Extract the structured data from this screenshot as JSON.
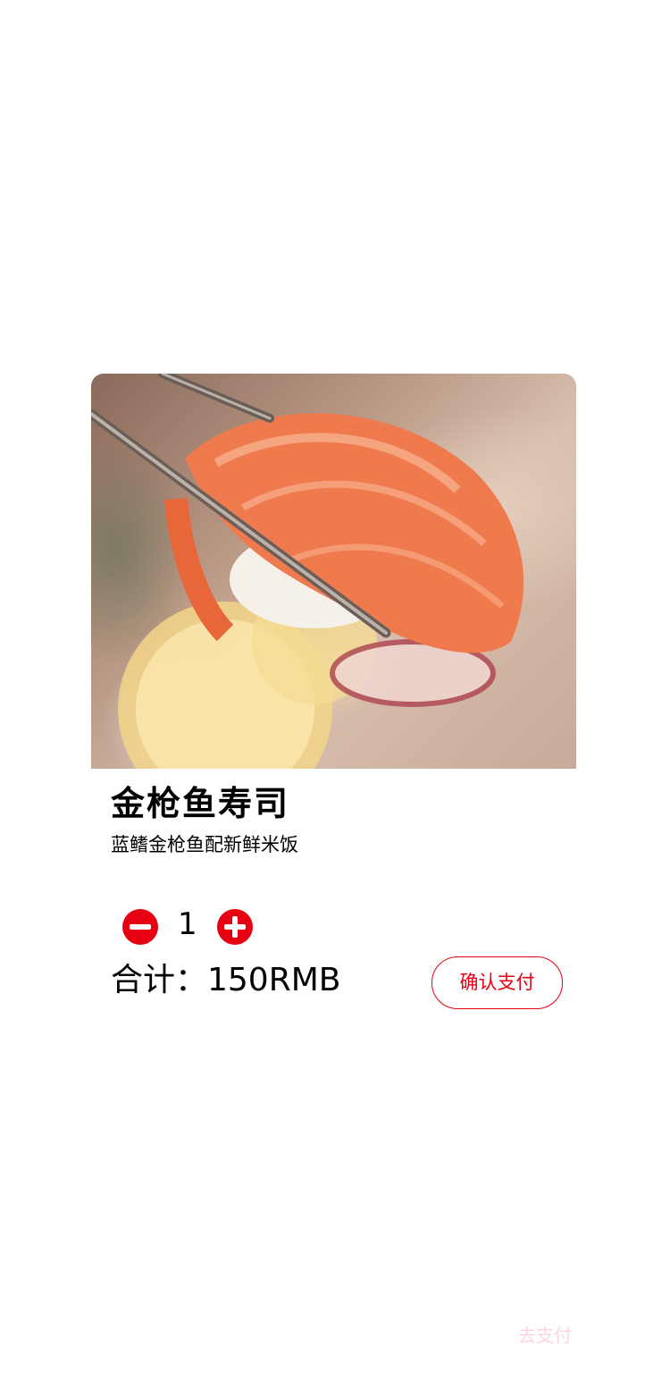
{
  "product": {
    "name": "金枪鱼寿司",
    "description": "蓝鳍金枪鱼配新鲜米饭",
    "image_label": "salmon nigiri sushi held with chopsticks"
  },
  "order": {
    "quantity": "1",
    "total_text": "合计：150RMB",
    "pay_button_label": "确认支付"
  },
  "watermark": "去支付",
  "colors": {
    "accent": "#e60012",
    "background": "#ffffff"
  }
}
